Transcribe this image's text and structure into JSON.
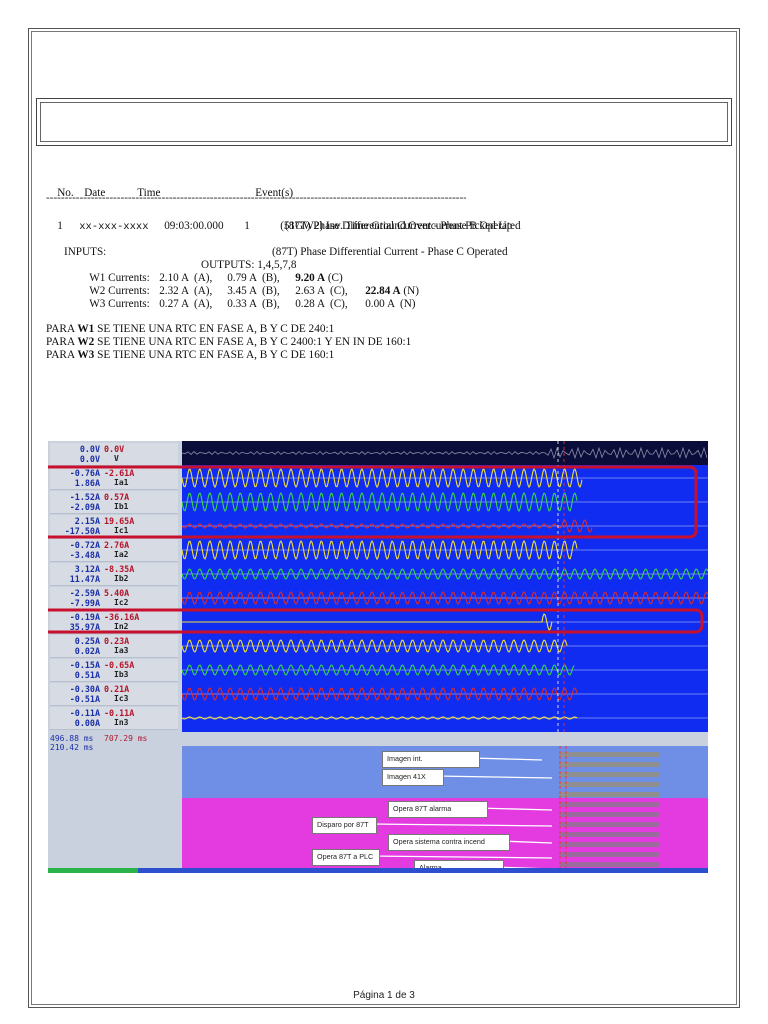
{
  "report": {
    "headers": {
      "no": "No.",
      "date": "Date",
      "time": "Time",
      "events": "Event(s)"
    },
    "dashes": "------------------------------------------------------------------------------------------------------------------------",
    "event_no": "1",
    "event_date": "xx-xxx-xxxx",
    "event_time": "09:03:00.000",
    "event_idx": "1",
    "events": [
      "(51GW2) Inv. Time Ground Overcurrent Picked Up",
      "(87T) Phase Differential Current - Phase B Operated",
      "(87T) Phase Differential Current - Phase C Operated"
    ],
    "inputs_label": "INPUTS:",
    "outputs_label": "OUTPUTS: 1,4,5,7,8",
    "currents": [
      {
        "label": "W1 Currents:",
        "a": "2.10 A  (A),",
        "b": "0.79 A  (B),",
        "c": "9.20 A",
        "c_tag": " (C)",
        "c_bold": true
      },
      {
        "label": "W2 Currents:",
        "a": "2.32 A  (A),",
        "b": "3.45 A  (B),",
        "c": "2.63 A  (C),",
        "n": "22.84 A",
        "n_tag": " (N)",
        "n_bold": true
      },
      {
        "label": "W3 Currents:",
        "a": "0.27 A  (A),",
        "b": "0.33 A  (B),",
        "c": "0.28 A  (C),",
        "n": "0.00 A",
        "n_tag": "  (N)"
      }
    ]
  },
  "notes": [
    {
      "pre": "PARA ",
      "w": "W1",
      "post": " SE TIENE UNA RTC EN FASE A, B Y C DE 240:1"
    },
    {
      "pre": "PARA ",
      "w": "W2",
      "post": " SE TIENE UNA RTC EN FASE A, B Y C 2400:1 Y EN IN DE 160:1"
    },
    {
      "pre": "PARA ",
      "w": "W3",
      "post": " SE TIENE UNA RTC EN FASE A, B Y C DE 160:1"
    }
  ],
  "scope": {
    "channels": [
      {
        "v1": "0.0V",
        "v2": "0.0V",
        "v1b": "0.0V",
        "tag": "V"
      },
      {
        "v1": "-0.76A",
        "v2": "-2.61A",
        "v1b": "1.86A",
        "tag": "Ia1"
      },
      {
        "v1": "-1.52A",
        "v2": "0.57A",
        "v1b": "-2.09A",
        "tag": "Ib1"
      },
      {
        "v1": "2.15A",
        "v2": "19.65A",
        "v1b": "-17.50A",
        "tag": "Ic1"
      },
      {
        "v1": "-0.72A",
        "v2": "2.76A",
        "v1b": "-3.48A",
        "tag": "Ia2"
      },
      {
        "v1": "3.12A",
        "v2": "-8.35A",
        "v1b": "11.47A",
        "tag": "Ib2"
      },
      {
        "v1": "-2.59A",
        "v2": "5.40A",
        "v1b": "-7.99A",
        "tag": "Ic2"
      },
      {
        "v1": "-0.19A",
        "v2": "-36.16A",
        "v1b": "35.97A",
        "tag": "In2"
      },
      {
        "v1": "0.25A",
        "v2": "0.23A",
        "v1b": "0.02A",
        "tag": "Ia3"
      },
      {
        "v1": "-0.15A",
        "v2": "-0.65A",
        "v1b": "0.51A",
        "tag": "Ib3"
      },
      {
        "v1": "-0.30A",
        "v2": "0.21A",
        "v1b": "-0.51A",
        "tag": "Ic3"
      },
      {
        "v1": "-0.11A",
        "v2": "-0.11A",
        "v1b": "0.00A",
        "tag": "In3"
      }
    ],
    "time1": "496.88 ms",
    "time2": "707.29 ms",
    "time3": "210.42 ms",
    "callouts": [
      "Imagen int.",
      "Imagen 41X",
      "Opera 87T alarma",
      "Disparo por 87T",
      "Opera sistema contra incend",
      "Opera 87T a PLC",
      "Alarma"
    ],
    "colors": {
      "phase_a": "#f2e23a",
      "phase_b": "#37d84a",
      "phase_c": "#e02a2a",
      "highlight": "#c8102e",
      "background": "#0f2cf0"
    }
  },
  "footer": "Página 1 de 3"
}
